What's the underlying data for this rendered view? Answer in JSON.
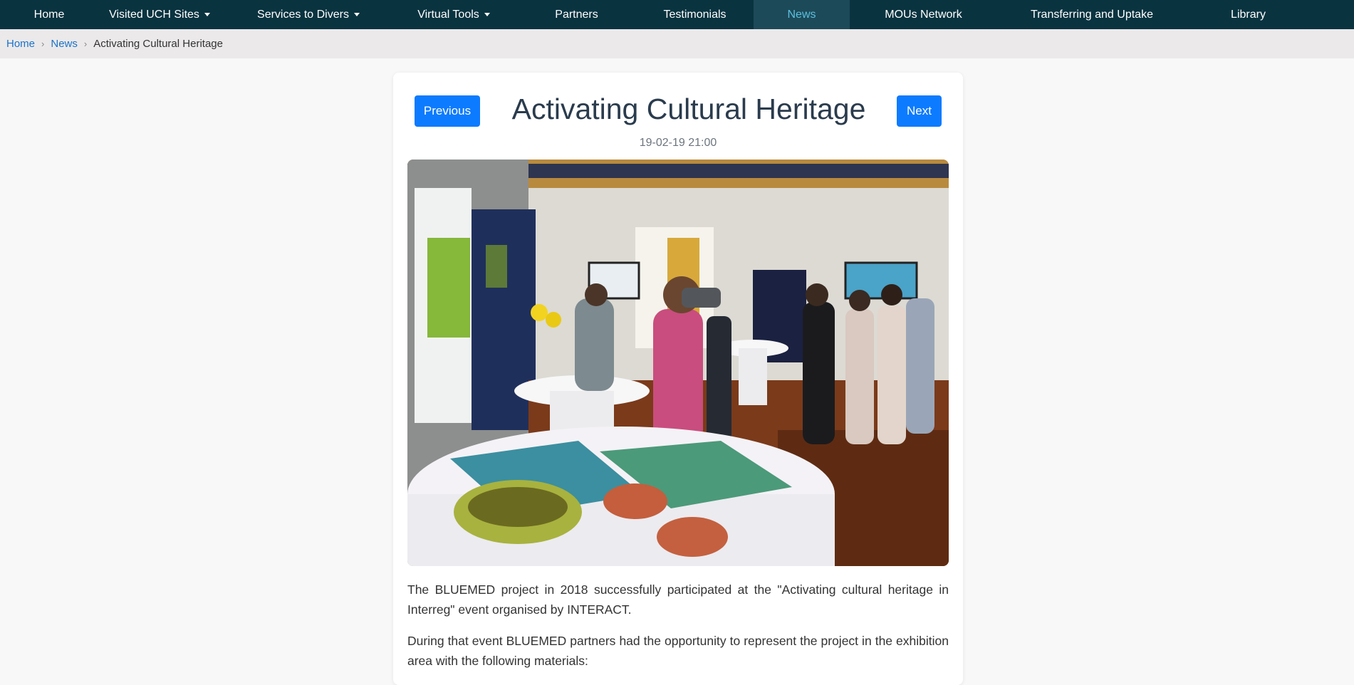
{
  "nav": {
    "items": [
      {
        "label": "Home",
        "dropdown": false,
        "active": false
      },
      {
        "label": "Visited UCH Sites",
        "dropdown": true,
        "active": false
      },
      {
        "label": "Services to Divers",
        "dropdown": true,
        "active": false
      },
      {
        "label": "Virtual Tools",
        "dropdown": true,
        "active": false
      },
      {
        "label": "Partners",
        "dropdown": false,
        "active": false
      },
      {
        "label": "Testimonials",
        "dropdown": false,
        "active": false
      },
      {
        "label": "News",
        "dropdown": false,
        "active": true
      },
      {
        "label": "MOUs Network",
        "dropdown": false,
        "active": false
      },
      {
        "label": "Transferring and Uptake",
        "dropdown": false,
        "active": false
      },
      {
        "label": "Library",
        "dropdown": false,
        "active": false
      }
    ]
  },
  "breadcrumb": {
    "home": "Home",
    "news": "News",
    "current": "Activating Cultural Heritage",
    "separator": "›"
  },
  "article": {
    "prev_label": "Previous",
    "next_label": "Next",
    "title": "Activating Cultural Heritage",
    "date": "19-02-19 21:00",
    "paragraphs": [
      "The BLUEMED project in 2018 successfully participated at the \"Activating cultural heritage in Interreg\" event organised by INTERACT.",
      "During that event BLUEMED partners had the opportunity to represent the project in the exhibition area with the following materials:"
    ]
  },
  "colors": {
    "nav_bg": "#0a3340",
    "nav_active_text": "#5bc0de",
    "button_bg": "#0d7bff",
    "link": "#1a73c9"
  }
}
